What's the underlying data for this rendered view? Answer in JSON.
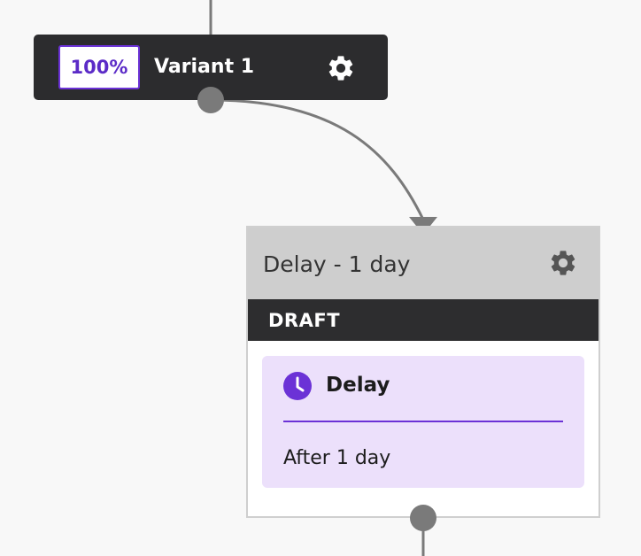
{
  "variant_node": {
    "percent": "100%",
    "title": "Variant 1",
    "settings_icon": "gear-icon"
  },
  "delay_node": {
    "header_title": "Delay - 1 day",
    "settings_icon": "gear-icon",
    "status": "DRAFT",
    "action": {
      "icon": "clock-icon",
      "title": "Delay",
      "detail": "After 1 day"
    }
  },
  "colors": {
    "canvas": "#f8f8f8",
    "dark_node": "#2c2c2e",
    "accent_purple": "#6b32d6",
    "card_lavender": "#ece0fb",
    "header_gray": "#cecece",
    "connector_gray": "#7a7a7a"
  }
}
